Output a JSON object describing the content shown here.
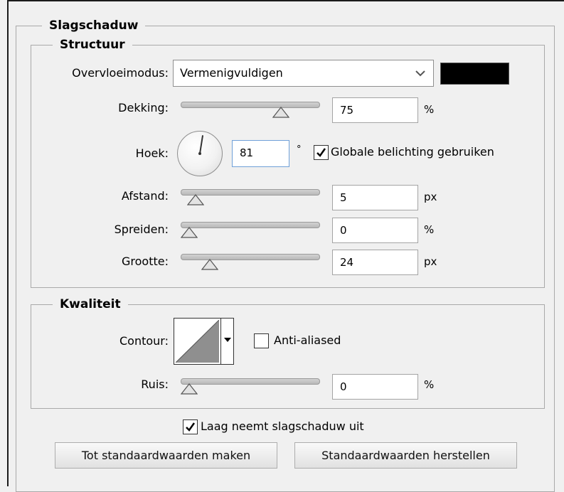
{
  "dialog": {
    "section_title": "Slagschaduw",
    "structure": {
      "title": "Structuur",
      "blend_mode": {
        "label": "Overvloeimodus:",
        "value": "Vermenigvuldigen",
        "color": "#000000"
      },
      "opacity": {
        "label": "Dekking:",
        "value": "75",
        "unit": "%",
        "slider_fraction": 0.75
      },
      "angle": {
        "label": "Hoek:",
        "value": "81",
        "unit": "°",
        "global_light_label": "Globale belichting gebruiken",
        "global_light_checked": true
      },
      "distance": {
        "label": "Afstand:",
        "value": "5",
        "unit": "px",
        "slider_fraction": 0.05
      },
      "spread": {
        "label": "Spreiden:",
        "value": "0",
        "unit": "%",
        "slider_fraction": 0.0
      },
      "size": {
        "label": "Grootte:",
        "value": "24",
        "unit": "px",
        "slider_fraction": 0.17
      }
    },
    "quality": {
      "title": "Kwaliteit",
      "contour": {
        "label": "Contour:",
        "anti_aliased_label": "Anti-aliased",
        "anti_aliased_checked": false
      },
      "noise": {
        "label": "Ruis:",
        "value": "0",
        "unit": "%",
        "slider_fraction": 0.0
      }
    },
    "layer_knocks_out": {
      "label": "Laag neemt slagschaduw uit",
      "checked": true
    },
    "buttons": {
      "make_default": "Tot standaardwaarden maken",
      "reset_default": "Standaardwaarden herstellen"
    }
  }
}
